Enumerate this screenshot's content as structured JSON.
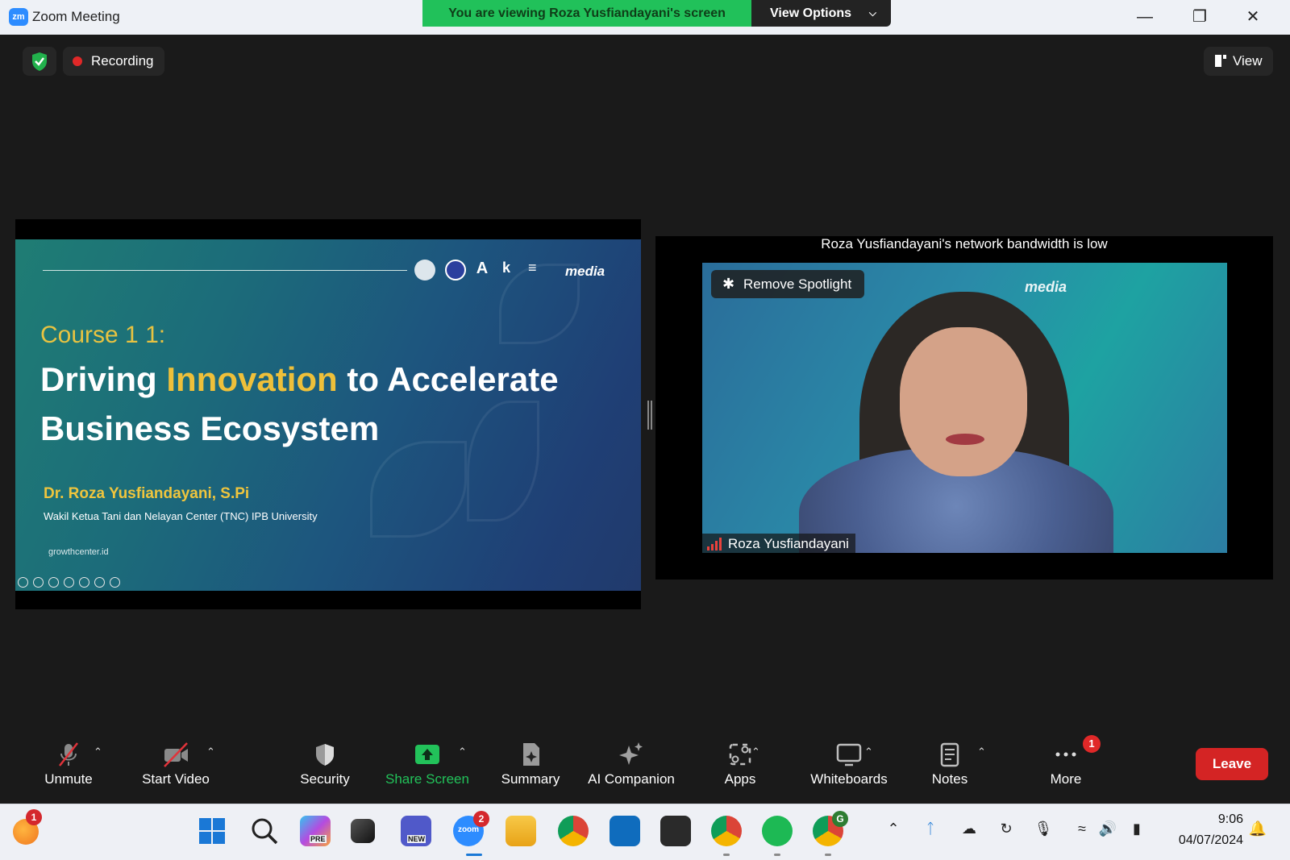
{
  "window": {
    "title": "Zoom Meeting",
    "logo_text": "zm",
    "share_banner": "You are viewing Roza Yusfiandayani's screen",
    "view_options": "View Options"
  },
  "meeting": {
    "recording_label": "Recording",
    "view_label": "View"
  },
  "slide": {
    "course": "Course 1 1:",
    "title_part1": "Driving ",
    "title_highlight": "Innovation",
    "title_part2": " to Accelerate Business Ecosystem",
    "presenter": "Dr. Roza Yusfiandayani, S.Pi",
    "affiliation": "Wakil Ketua Tani dan Nelayan Center (TNC) IPB University",
    "website": "growthcenter.id",
    "logo_text": "media"
  },
  "video": {
    "bandwidth_message": "Roza Yusfiandayani's network bandwidth is low",
    "remove_spotlight": "Remove Spotlight",
    "participant_name": "Roza Yusfiandayani",
    "logo_text": "media"
  },
  "toolbar": {
    "unmute": "Unmute",
    "start_video": "Start Video",
    "security": "Security",
    "share_screen": "Share Screen",
    "summary": "Summary",
    "ai_companion": "AI Companion",
    "apps": "Apps",
    "whiteboards": "Whiteboards",
    "notes": "Notes",
    "more": "More",
    "more_badge": "1",
    "leave": "Leave",
    "share_color": "#22c25a",
    "leave_color": "#d42424"
  },
  "taskbar": {
    "widget_badge": "1",
    "zoom_badge": "2",
    "copilot_tag": "PRE",
    "teams_tag": "NEW",
    "zoom_label": "zoom",
    "chrome_profile": "G",
    "time": "9:06",
    "date": "04/07/2024"
  }
}
